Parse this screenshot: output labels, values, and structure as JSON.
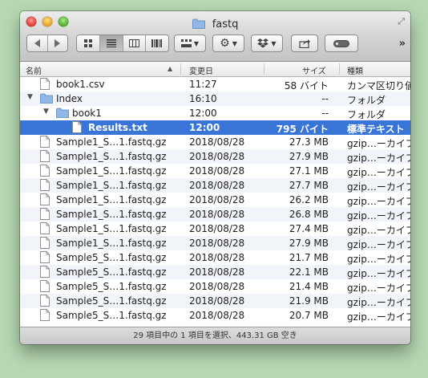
{
  "window": {
    "title": "fastq",
    "fullscreen_icon": "fullscreen-arrows-icon"
  },
  "toolbar": {
    "back_icon": "back-arrow-icon",
    "forward_icon": "forward-arrow-icon",
    "view_modes": [
      "icon-view",
      "list-view",
      "column-view",
      "coverflow-view"
    ],
    "active_view": "list-view",
    "arrange_icon": "arrange-icon",
    "action_icon": "gear-icon",
    "dropbox_icon": "dropbox-icon",
    "share_icon": "share-icon",
    "tags_icon": "tag-pill-icon",
    "overflow_label": "»"
  },
  "columns": {
    "name": "名前",
    "date": "変更日",
    "size": "サイズ",
    "kind": "種類"
  },
  "rows": [
    {
      "indent": 0,
      "disclosure": "",
      "type": "file",
      "name": "book1.csv",
      "date": "11:27",
      "size": "58 バイト",
      "kind": "カンマ区切り値",
      "selected": false
    },
    {
      "indent": 0,
      "disclosure": "▼",
      "type": "folder",
      "name": "Index",
      "date": "16:10",
      "size": "--",
      "kind": "フォルダ",
      "selected": false
    },
    {
      "indent": 1,
      "disclosure": "▼",
      "type": "folder",
      "name": "book1",
      "date": "12:00",
      "size": "--",
      "kind": "フォルダ",
      "selected": false
    },
    {
      "indent": 2,
      "disclosure": "",
      "type": "file",
      "name": "Results.txt",
      "date": "12:00",
      "size": "795 バイト",
      "kind": "標準テキスト",
      "selected": true
    },
    {
      "indent": 0,
      "disclosure": "",
      "type": "file",
      "name": "Sample1_S…1.fastq.gz",
      "date": "2018/08/28",
      "size": "27.3 MB",
      "kind": "gzip…ーカイブ",
      "selected": false
    },
    {
      "indent": 0,
      "disclosure": "",
      "type": "file",
      "name": "Sample1_S…1.fastq.gz",
      "date": "2018/08/28",
      "size": "27.9 MB",
      "kind": "gzip…ーカイブ",
      "selected": false
    },
    {
      "indent": 0,
      "disclosure": "",
      "type": "file",
      "name": "Sample1_S…1.fastq.gz",
      "date": "2018/08/28",
      "size": "27.1 MB",
      "kind": "gzip…ーカイブ",
      "selected": false
    },
    {
      "indent": 0,
      "disclosure": "",
      "type": "file",
      "name": "Sample1_S…1.fastq.gz",
      "date": "2018/08/28",
      "size": "27.7 MB",
      "kind": "gzip…ーカイブ",
      "selected": false
    },
    {
      "indent": 0,
      "disclosure": "",
      "type": "file",
      "name": "Sample1_S…1.fastq.gz",
      "date": "2018/08/28",
      "size": "26.2 MB",
      "kind": "gzip…ーカイブ",
      "selected": false
    },
    {
      "indent": 0,
      "disclosure": "",
      "type": "file",
      "name": "Sample1_S…1.fastq.gz",
      "date": "2018/08/28",
      "size": "26.8 MB",
      "kind": "gzip…ーカイブ",
      "selected": false
    },
    {
      "indent": 0,
      "disclosure": "",
      "type": "file",
      "name": "Sample1_S…1.fastq.gz",
      "date": "2018/08/28",
      "size": "27.4 MB",
      "kind": "gzip…ーカイブ",
      "selected": false
    },
    {
      "indent": 0,
      "disclosure": "",
      "type": "file",
      "name": "Sample1_S…1.fastq.gz",
      "date": "2018/08/28",
      "size": "27.9 MB",
      "kind": "gzip…ーカイブ",
      "selected": false
    },
    {
      "indent": 0,
      "disclosure": "",
      "type": "file",
      "name": "Sample5_S…1.fastq.gz",
      "date": "2018/08/28",
      "size": "21.7 MB",
      "kind": "gzip…ーカイブ",
      "selected": false
    },
    {
      "indent": 0,
      "disclosure": "",
      "type": "file",
      "name": "Sample5_S…1.fastq.gz",
      "date": "2018/08/28",
      "size": "22.1 MB",
      "kind": "gzip…ーカイブ",
      "selected": false
    },
    {
      "indent": 0,
      "disclosure": "",
      "type": "file",
      "name": "Sample5_S…1.fastq.gz",
      "date": "2018/08/28",
      "size": "21.4 MB",
      "kind": "gzip…ーカイブ",
      "selected": false
    },
    {
      "indent": 0,
      "disclosure": "",
      "type": "file",
      "name": "Sample5_S…1.fastq.gz",
      "date": "2018/08/28",
      "size": "21.9 MB",
      "kind": "gzip…ーカイブ",
      "selected": false
    },
    {
      "indent": 0,
      "disclosure": "",
      "type": "file",
      "name": "Sample5_S…1.fastq.gz",
      "date": "2018/08/28",
      "size": "20.7 MB",
      "kind": "gzip…ーカイブ",
      "selected": false
    }
  ],
  "status": {
    "text": "29 項目中の 1 項目を選択、443.31 GB 空き"
  },
  "colors": {
    "selection": "#3875d7",
    "alt_row": "#f1f5fa",
    "folder": "#8fb8e6"
  }
}
